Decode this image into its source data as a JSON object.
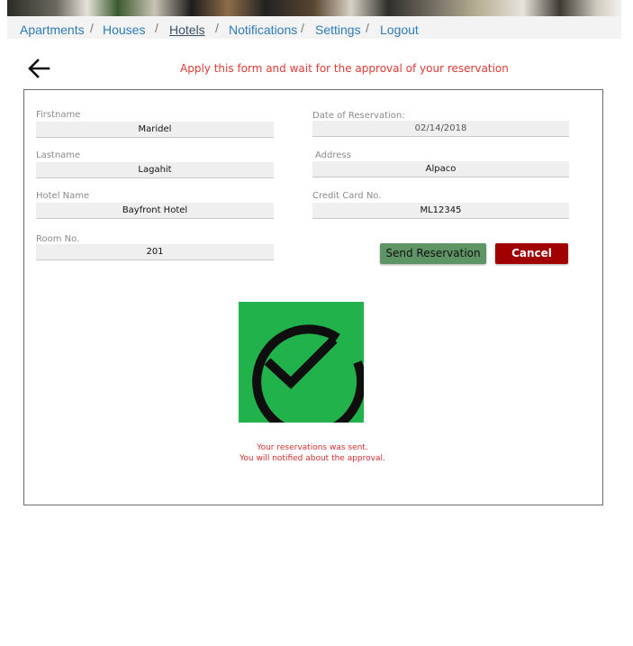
{
  "nav": {
    "items": [
      "Apartments",
      "Houses",
      "Hotels",
      "Notifications",
      "Settings",
      "Logout"
    ],
    "separator": "/",
    "active": "Hotels"
  },
  "header": {
    "back_icon": "arrow-left-icon",
    "notice": "Apply this form and wait for the approval of your reservation"
  },
  "form": {
    "firstname": {
      "label": "Firstname",
      "value": "Maridel"
    },
    "lastname": {
      "label": "Lastname",
      "value": "Lagahit"
    },
    "hotel_name": {
      "label": "Hotel Name",
      "value": "Bayfront Hotel"
    },
    "room_no": {
      "label": "Room No.",
      "value": "201"
    },
    "date_of_reservation": {
      "label": "Date of Reservation:",
      "value": "02/14/2018"
    },
    "address": {
      "label": "Address",
      "value": "Alpaco"
    },
    "credit_card_no": {
      "label": "Credit Card No.",
      "value": "ML12345"
    }
  },
  "buttons": {
    "send": "Send Reservation",
    "cancel": "Cancel"
  },
  "success": {
    "icon": "check-circle-icon",
    "line1": "Your reservations was sent.",
    "line2": "You will notified about the approval."
  },
  "colors": {
    "link": "#2e7bb8",
    "notice": "#e53935",
    "send_button": "#5f9564",
    "cancel_button": "#a10000",
    "success_box": "#22b24c"
  }
}
